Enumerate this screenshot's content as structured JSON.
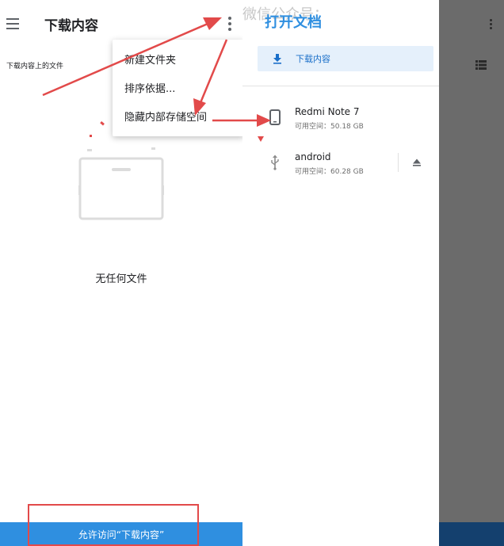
{
  "left_panel": {
    "title": "下载内容",
    "subtitle": "下载内容上的文件",
    "empty_text": "无任何文件",
    "allow_button_label": "允许访问“下载内容”"
  },
  "menu": {
    "items": [
      {
        "label": "新建文件夹"
      },
      {
        "label": "排序依据..."
      },
      {
        "label": "隐藏内部存储空间"
      }
    ]
  },
  "drawer": {
    "watermark": "微信公众号：",
    "title": "打开文档",
    "nav_item_label": "下载内容",
    "storages": [
      {
        "name": "Redmi Note 7",
        "free": "可用空间：50.18 GB"
      },
      {
        "name": "android",
        "free": "可用空间：60.28 GB"
      }
    ]
  },
  "icons": {
    "menu": "hamburger-menu-icon",
    "more": "more-vert-icon",
    "download": "download-icon",
    "phone": "phone-icon",
    "usb": "usb-icon",
    "eject": "eject-icon",
    "list": "list-view-icon"
  },
  "colors": {
    "accent": "#2f8fe0",
    "annotation_red": "#e24a4a",
    "nav_highlight": "#e5f0fb",
    "dim_panel": "#6b6b6b"
  }
}
